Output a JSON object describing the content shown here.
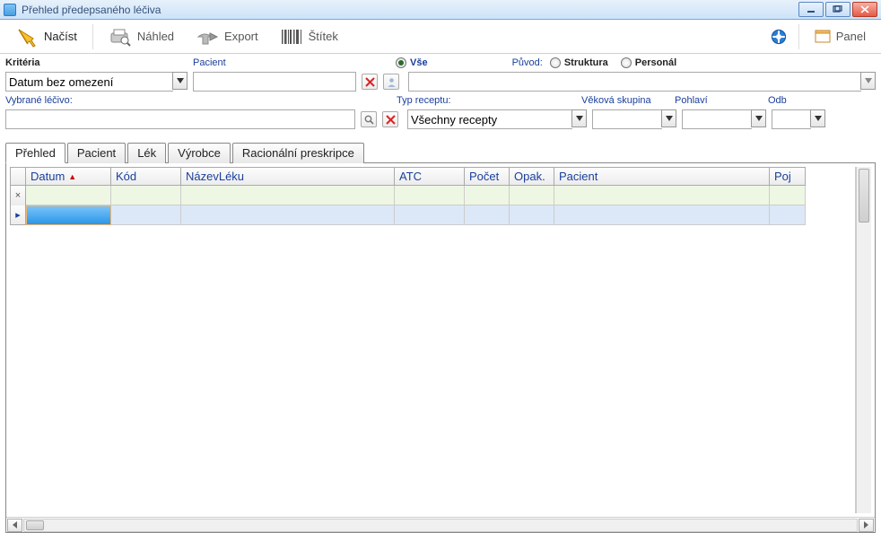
{
  "window": {
    "title": "Přehled předepsaného léčiva"
  },
  "toolbar": {
    "load": "Načíst",
    "preview": "Náhled",
    "export": "Export",
    "label": "Štítek",
    "panel": "Panel"
  },
  "criteria": {
    "heading": "Kritéria",
    "pacient_label": "Pacient",
    "date_select_value": "Datum bez omezení",
    "origin_label": "Původ:",
    "radio_all": "Vše",
    "radio_struct": "Struktura",
    "radio_personal": "Personál",
    "selected_drug_label": "Vybrané léčivo:",
    "recipe_type_label": "Typ receptu:",
    "recipe_type_value": "Všechny recepty",
    "age_group_label": "Věková skupina",
    "age_group_value": "",
    "gender_label": "Pohlaví",
    "gender_value": "",
    "odb_label": "Odb",
    "odb_value": ""
  },
  "tabs": {
    "overview": "Přehled",
    "pacient": "Pacient",
    "drug": "Lék",
    "manufacturer": "Výrobce",
    "rational": "Racionální preskripce"
  },
  "grid": {
    "columns": {
      "date": "Datum",
      "code": "Kód",
      "drugname": "NázevLéku",
      "atc": "ATC",
      "count": "Počet",
      "repeat": "Opak.",
      "pacient": "Pacient",
      "poj": "Poj"
    },
    "rowmarker_filter": "×",
    "rowmarker_current": "▸"
  }
}
